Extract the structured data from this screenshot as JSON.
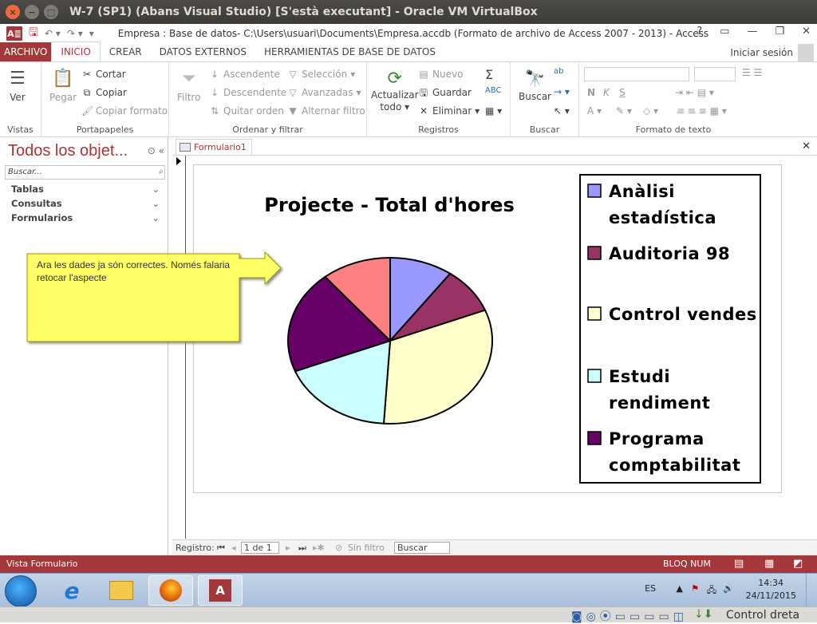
{
  "vbox": {
    "title": "W-7 (SP1) (Abans Visual Studio) [S'està executant] - Oracle VM VirtualBox",
    "status_right": "Control dreta"
  },
  "access": {
    "doc_title": "Empresa : Base de datos- C:\\Users\\usuari\\Documents\\Empresa.accdb (Formato de archivo de Access 2007 - 2013) - Access",
    "logo": "A≣"
  },
  "tabs": [
    "ARCHIVO",
    "INICIO",
    "CREAR",
    "DATOS EXTERNOS",
    "HERRAMIENTAS DE BASE DE DATOS"
  ],
  "signin": "Iniciar sesión",
  "ribbon": {
    "vistas": {
      "ver": "Ver",
      "label": "Vistas"
    },
    "portapapeles": {
      "pegar": "Pegar",
      "cortar": "Cortar",
      "copiar": "Copiar",
      "copiar_formato": "Copiar formato",
      "label": "Portapapeles"
    },
    "ordenar": {
      "filtro": "Filtro",
      "ascendente": "Ascendente",
      "descendente": "Descendente",
      "quitar_orden": "Quitar orden",
      "seleccion": "Selección",
      "avanzadas": "Avanzadas",
      "alternar": "Alternar filtro",
      "label": "Ordenar y filtrar"
    },
    "registros": {
      "actualizar": "Actualizar",
      "todo": "todo",
      "nuevo": "Nuevo",
      "guardar": "Guardar",
      "eliminar": "Eliminar",
      "label": "Registros"
    },
    "buscar": {
      "buscar": "Buscar",
      "label": "Buscar"
    },
    "formato": {
      "label": "Formato de texto"
    }
  },
  "nav": {
    "title": "Todos los objet...",
    "search_placeholder": "Buscar...",
    "groups": [
      "Tablas",
      "Consultas",
      "Formularios"
    ]
  },
  "document": {
    "tab": "Formulario1"
  },
  "callout": {
    "text": "Ara les dades ja són correctes. Només falaria retocar l'aspecte"
  },
  "record_bar": {
    "label": "Registro:",
    "current": "1 de 1",
    "filter": "Sin filtro",
    "search": "Buscar"
  },
  "status": {
    "left": "Vista Formulario",
    "bloq": "BLOQ NUM"
  },
  "taskbar": {
    "lang": "ES",
    "time": "14:34",
    "date": "24/11/2015"
  },
  "colors": {
    "accent": "#a4373a",
    "callout_fill": "#ffff66",
    "callout_border": "#9b9b00"
  },
  "chart_data": {
    "type": "pie",
    "title": "Projecte - Total d'hores",
    "series": [
      {
        "name": "Anàlisi estadística",
        "value": 10,
        "color": "#9999ff"
      },
      {
        "name": "Auditoria 98",
        "value": 9,
        "color": "#993366"
      },
      {
        "name": "Control vendes",
        "value": 32,
        "color": "#ffffcc"
      },
      {
        "name": "Estudi rendiment",
        "value": 18,
        "color": "#ccffff"
      },
      {
        "name": "Programa comptabilitat",
        "value": 20,
        "color": "#660066"
      },
      {
        "name": "",
        "value": 11,
        "color": "#ff8080"
      }
    ],
    "legend": "right"
  }
}
